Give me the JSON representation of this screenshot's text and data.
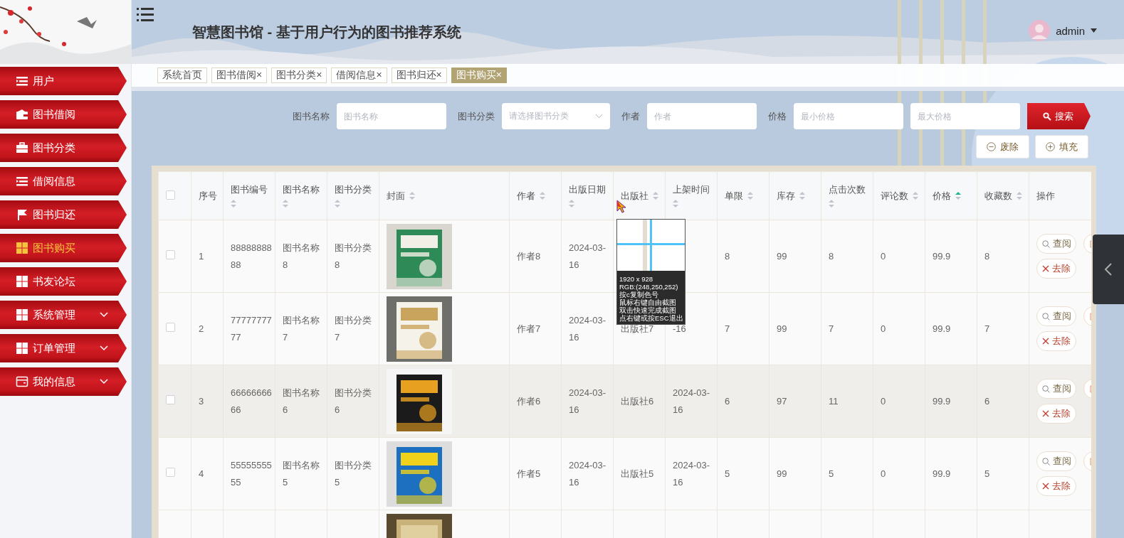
{
  "sidebar": {
    "items": [
      {
        "label": "用户",
        "selected": false,
        "has_submenu": false
      },
      {
        "label": "图书借阅",
        "selected": false,
        "has_submenu": false
      },
      {
        "label": "图书分类",
        "selected": false,
        "has_submenu": false
      },
      {
        "label": "借阅信息",
        "selected": false,
        "has_submenu": false
      },
      {
        "label": "图书归还",
        "selected": false,
        "has_submenu": false
      },
      {
        "label": "图书购买",
        "selected": true,
        "has_submenu": false
      },
      {
        "label": "书友论坛",
        "selected": false,
        "has_submenu": false
      },
      {
        "label": "系统管理",
        "selected": false,
        "has_submenu": true
      },
      {
        "label": "订单管理",
        "selected": false,
        "has_submenu": true
      },
      {
        "label": "我的信息",
        "selected": false,
        "has_submenu": true
      }
    ]
  },
  "header": {
    "title": "智慧图书馆 - 基于用户行为的图书推荐系统",
    "user": "admin"
  },
  "tabs": [
    {
      "label": "系统首页",
      "selected": false
    },
    {
      "label": "图书借阅",
      "close": "×",
      "selected": false
    },
    {
      "label": "图书分类",
      "close": "×",
      "selected": false
    },
    {
      "label": "借阅信息",
      "close": "×",
      "selected": false
    },
    {
      "label": "图书归还",
      "close": "×",
      "selected": false
    },
    {
      "label": "图书购买",
      "close": "×",
      "selected": true
    }
  ],
  "search": {
    "fields": [
      {
        "kind": "input",
        "label": "图书名称",
        "placeholder": "图书名称"
      },
      {
        "kind": "select",
        "label": "图书分类",
        "placeholder": "请选择图书分类"
      },
      {
        "kind": "input",
        "label": "作者",
        "placeholder": "作者"
      },
      {
        "kind": "input",
        "label": "价格",
        "placeholder": "最小价格"
      },
      {
        "kind": "input",
        "placeholder": "最大价格"
      }
    ],
    "button": "搜索"
  },
  "actions": [
    {
      "kind": "remove",
      "label": "废除"
    },
    {
      "kind": "add",
      "label": "填充"
    }
  ],
  "table": {
    "select_all": {
      "checked": false
    },
    "columns": [
      {
        "kind": "text",
        "label": "序号",
        "sortable": false
      },
      {
        "kind": "text",
        "label": "图书编号",
        "sortable": true
      },
      {
        "kind": "text",
        "label": "图书名称",
        "sortable": true
      },
      {
        "kind": "text",
        "label": "图书分类",
        "sortable": true
      },
      {
        "kind": "cover",
        "label": "封面",
        "sortable": true
      },
      {
        "kind": "text",
        "label": "作者",
        "sortable": true
      },
      {
        "kind": "text",
        "label": "出版日期",
        "sortable": true
      },
      {
        "kind": "text",
        "label": "出版社",
        "sortable": true
      },
      {
        "kind": "text",
        "label": "上架时间",
        "sortable": true
      },
      {
        "kind": "text",
        "label": "单限",
        "sortable": true
      },
      {
        "kind": "text",
        "label": "库存",
        "sortable": true
      },
      {
        "kind": "text",
        "label": "点击次数",
        "sortable": true
      },
      {
        "kind": "text",
        "label": "评论数",
        "sortable": true
      },
      {
        "kind": "text",
        "label": "价格",
        "sortable": true,
        "sorted_ascending": true
      },
      {
        "kind": "text",
        "label": "收藏数",
        "sortable": true
      },
      {
        "kind": "actions",
        "label": "操作",
        "sortable": false
      }
    ],
    "rows": [
      {
        "checked": false,
        "hovered": false,
        "cells": [
          "1",
          "8888888888",
          "图书名称8",
          "图书分类8",
          "作者8",
          "2024-03-16",
          null,
          null,
          "8",
          "99",
          "8",
          "0",
          "99.9",
          "8"
        ],
        "actions": [
          "查阅",
          "去除"
        ]
      },
      {
        "checked": false,
        "hovered": false,
        "cells": [
          "2",
          "7777777777",
          "图书名称7",
          "图书分类7",
          "作者7",
          "2024-03-16",
          "出版社7",
          "-16",
          "7",
          "99",
          "7",
          "0",
          "99.9",
          "7"
        ],
        "actions": [
          "查阅",
          "去除"
        ]
      },
      {
        "checked": false,
        "hovered": true,
        "cells": [
          "3",
          "6666666666",
          "图书名称6",
          "图书分类6",
          "作者6",
          "2024-03-16",
          "出版社6",
          "2024-03-16",
          "6",
          "97",
          "11",
          "0",
          "99.9",
          "6"
        ],
        "actions": [
          "查阅",
          "去除"
        ]
      },
      {
        "checked": false,
        "hovered": false,
        "cells": [
          "4",
          "5555555555",
          "图书名称5",
          "图书分类5",
          "作者5",
          "2024-03-16",
          "出版社5",
          "2024-03-16",
          "5",
          "99",
          "5",
          "0",
          "99.9",
          "5"
        ],
        "actions": [
          "查阅",
          "去除"
        ]
      },
      {
        "hovered": false
      }
    ]
  },
  "magnifier": {
    "lines": [
      "1920 x 928",
      "RGB:(248,250,252)",
      "按c复制色号",
      "鼠标右键自由截图",
      "双击快速完成截图",
      "点右键或按ESC退出"
    ]
  }
}
